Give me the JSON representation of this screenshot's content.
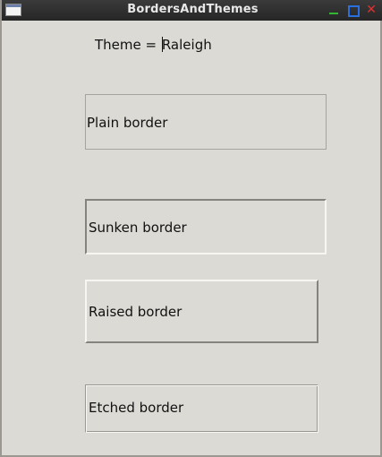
{
  "window": {
    "title": "BordersAndThemes",
    "controls": {
      "minimize_icon": "minimize-icon",
      "maximize_icon": "maximize-icon",
      "close_icon": "close-icon",
      "close_glyph": "✕"
    }
  },
  "theme": {
    "prefix": "Theme = ",
    "name": "Raleigh"
  },
  "panels": {
    "plain": {
      "label": "Plain border"
    },
    "sunken": {
      "label": "Sunken border"
    },
    "raised": {
      "label": "Raised border"
    },
    "etched": {
      "label": "Etched border"
    }
  }
}
